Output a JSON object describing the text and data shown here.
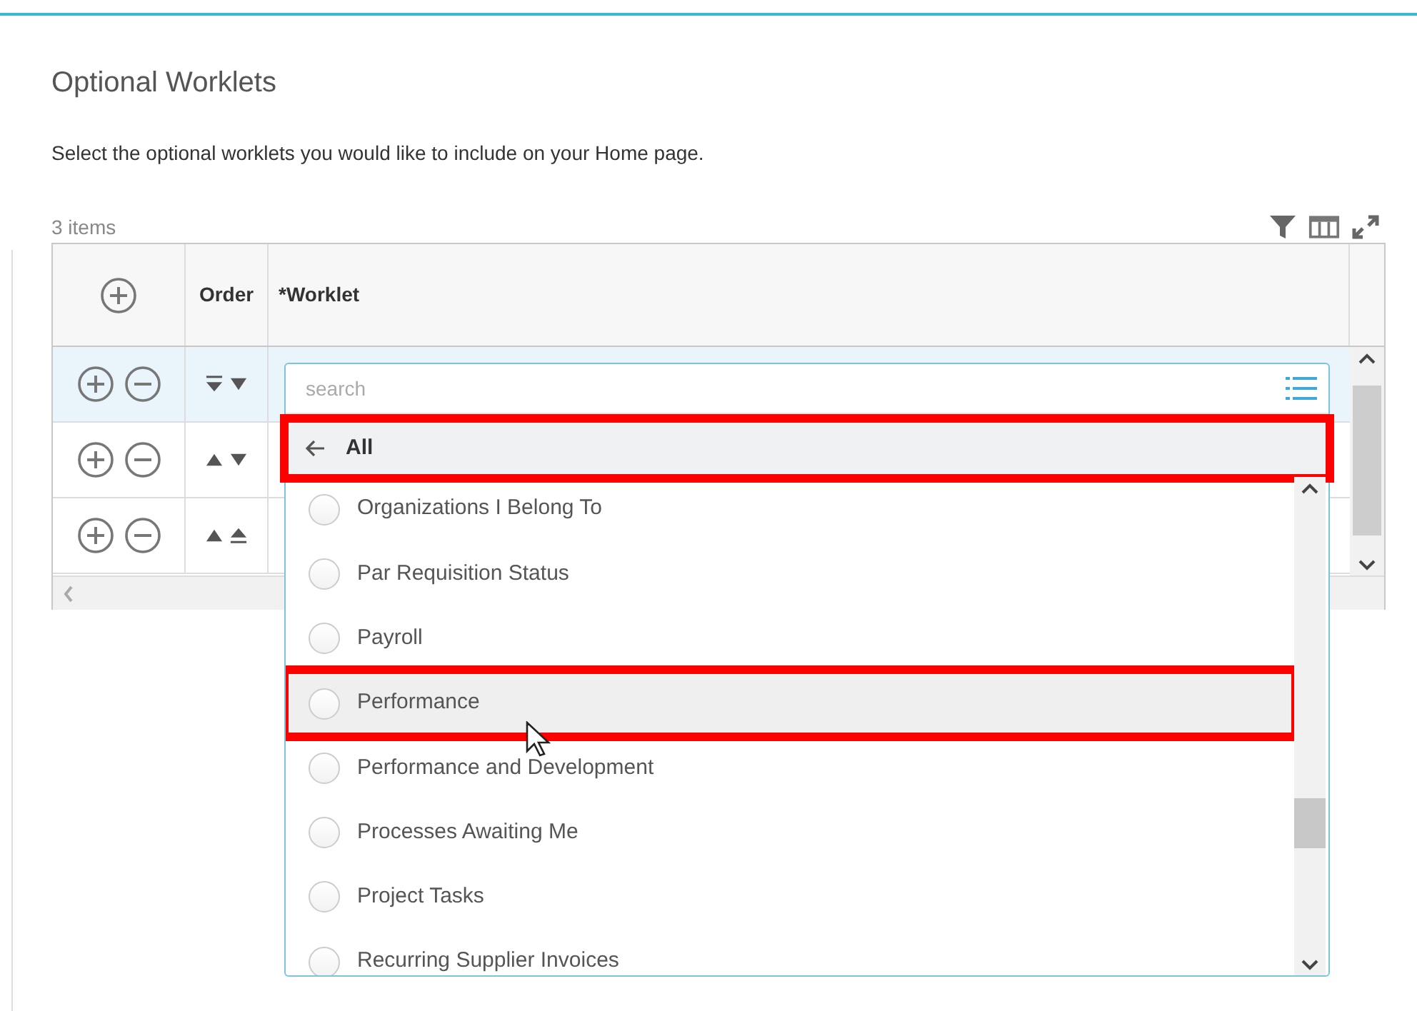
{
  "page": {
    "title": "Optional Worklets",
    "description": "Select the optional worklets you would like to include on your Home page.",
    "item_count": "3 items"
  },
  "table": {
    "columns": [
      "Order",
      "*Worklet"
    ],
    "rows": [
      {
        "selected": true,
        "order_buttons": [
          {
            "kind": "bar-down"
          },
          {
            "kind": "down"
          }
        ]
      },
      {
        "selected": false,
        "order_buttons": [
          {
            "kind": "up"
          },
          {
            "kind": "down"
          }
        ]
      },
      {
        "selected": false,
        "order_buttons": [
          {
            "kind": "up"
          },
          {
            "kind": "up-bar"
          }
        ]
      }
    ]
  },
  "dropdown": {
    "placeholder": "search",
    "back": {
      "label": "All",
      "annotated": true
    },
    "options": [
      {
        "label": "Organizations I Belong To",
        "hovered": false,
        "annotated": false
      },
      {
        "label": "Par Requisition Status",
        "hovered": false,
        "annotated": false
      },
      {
        "label": "Payroll",
        "hovered": false,
        "annotated": false
      },
      {
        "label": "Performance",
        "hovered": true,
        "annotated": true
      },
      {
        "label": "Performance and Development",
        "hovered": false,
        "annotated": false
      },
      {
        "label": "Processes Awaiting Me",
        "hovered": false,
        "annotated": false
      },
      {
        "label": "Project Tasks",
        "hovered": false,
        "annotated": false
      },
      {
        "label": "Recurring Supplier Invoices",
        "hovered": false,
        "annotated": false
      }
    ]
  }
}
